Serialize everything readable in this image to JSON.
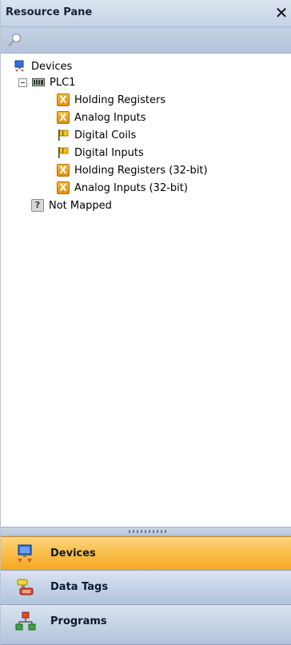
{
  "pane": {
    "title": "Resource Pane",
    "close_glyph": "✕"
  },
  "search": {
    "icon": "search-icon"
  },
  "tree": {
    "root_label": "Devices",
    "plc_label": "PLC1",
    "children": [
      {
        "label": "Holding Registers",
        "icon": "register-icon"
      },
      {
        "label": "Analog Inputs",
        "icon": "register-icon"
      },
      {
        "label": "Digital Coils",
        "icon": "flag-icon"
      },
      {
        "label": "Digital Inputs",
        "icon": "flag-icon"
      },
      {
        "label": "Holding Registers (32-bit)",
        "icon": "register-icon"
      },
      {
        "label": "Analog Inputs (32-bit)",
        "icon": "register-icon"
      }
    ],
    "unmapped_label": "Not Mapped"
  },
  "nav": {
    "devices_label": "Devices",
    "datatags_label": "Data Tags",
    "programs_label": "Programs",
    "active": "Devices"
  },
  "colors": {
    "accent": "#f9c04d",
    "header": "#c6d3e6"
  }
}
